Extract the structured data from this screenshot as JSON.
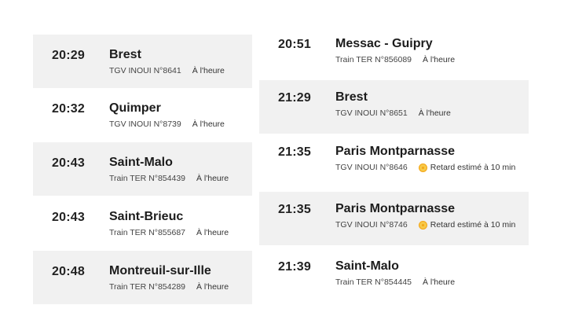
{
  "left_column": [
    {
      "time": "20:29",
      "destination": "Brest",
      "train": "TGV INOUI N°8641",
      "status": "À l'heure",
      "delayed": false
    },
    {
      "time": "20:32",
      "destination": "Quimper",
      "train": "TGV INOUI N°8739",
      "status": "À l'heure",
      "delayed": false
    },
    {
      "time": "20:43",
      "destination": "Saint-Malo",
      "train": "Train TER N°854439",
      "status": "À l'heure",
      "delayed": false
    },
    {
      "time": "20:43",
      "destination": "Saint-Brieuc",
      "train": "Train TER N°855687",
      "status": "À l'heure",
      "delayed": false
    },
    {
      "time": "20:48",
      "destination": "Montreuil-sur-Ille",
      "train": "Train TER N°854289",
      "status": "À l'heure",
      "delayed": false
    }
  ],
  "right_column": [
    {
      "time": "20:51",
      "destination": "Messac - Guipry",
      "train": "Train TER N°856089",
      "status": "À l'heure",
      "delayed": false
    },
    {
      "time": "21:29",
      "destination": "Brest",
      "train": "TGV INOUI N°8651",
      "status": "À l'heure",
      "delayed": false
    },
    {
      "time": "21:35",
      "destination": "Paris Montparnasse",
      "train": "TGV INOUI N°8646",
      "status": "Retard estimé à 10 min",
      "delayed": true
    },
    {
      "time": "21:35",
      "destination": "Paris Montparnasse",
      "train": "TGV INOUI N°8746",
      "status": "Retard estimé à 10 min",
      "delayed": true
    },
    {
      "time": "21:39",
      "destination": "Saint-Malo",
      "train": "Train TER N°854445",
      "status": "À l'heure",
      "delayed": false
    }
  ],
  "colors": {
    "row_shade": "#f1f1f1",
    "delay_icon": "#f7c948"
  }
}
